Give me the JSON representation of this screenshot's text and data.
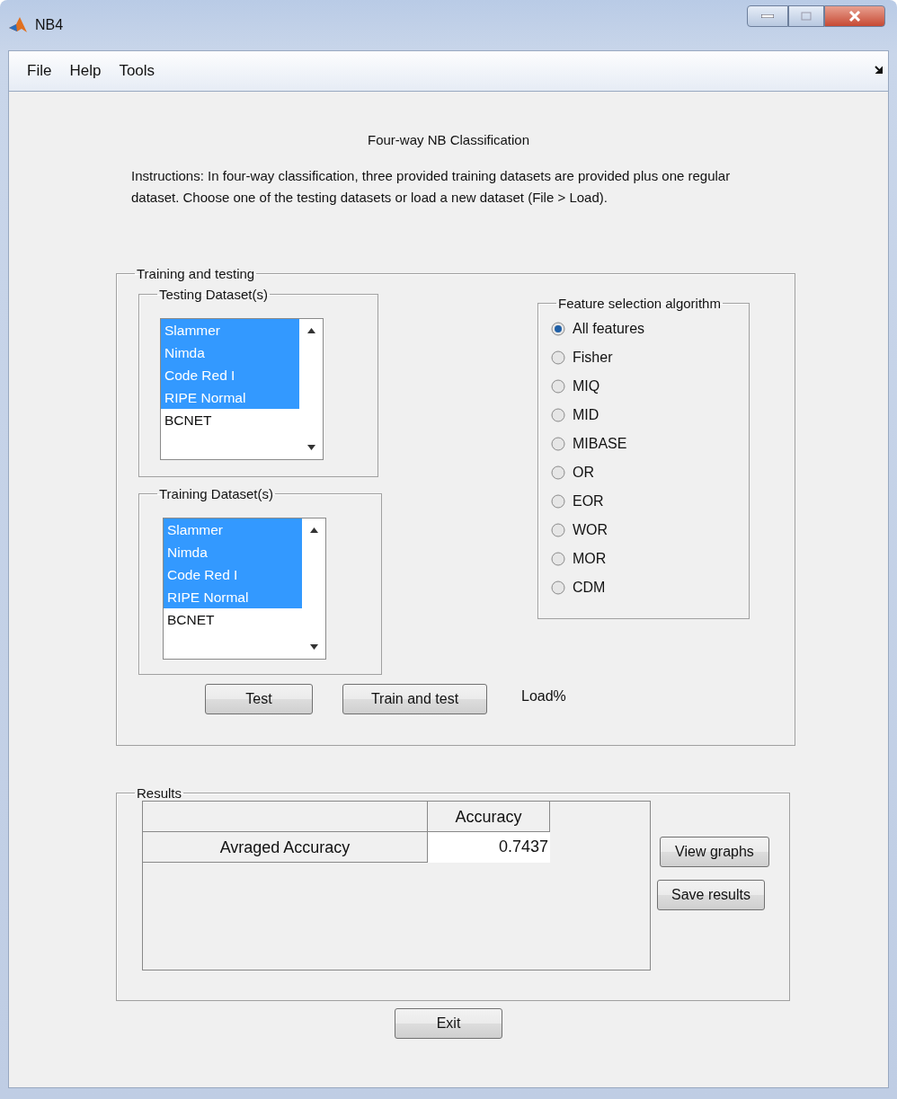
{
  "window": {
    "title": "NB4"
  },
  "menu": [
    "File",
    "Help",
    "Tools"
  ],
  "heading": "Four-way NB Classification",
  "instructions": "Instructions: In four-way classification, three provided training datasets are provided plus one regular dataset. Choose one of the testing datasets or load a new dataset (File > Load).",
  "training_panel": {
    "title": "Training and testing",
    "testing": {
      "title": "Testing Dataset(s)",
      "items": [
        {
          "label": "Slammer",
          "selected": true
        },
        {
          "label": "Nimda",
          "selected": true
        },
        {
          "label": "Code Red I",
          "selected": true
        },
        {
          "label": "RIPE Normal",
          "selected": true
        },
        {
          "label": "BCNET",
          "selected": false
        }
      ]
    },
    "training": {
      "title": "Training Dataset(s)",
      "items": [
        {
          "label": "Slammer",
          "selected": true
        },
        {
          "label": "Nimda",
          "selected": true
        },
        {
          "label": "Code Red I",
          "selected": true
        },
        {
          "label": "RIPE Normal",
          "selected": true
        },
        {
          "label": "BCNET",
          "selected": false
        }
      ]
    },
    "feature": {
      "title": "Feature selection algorithm",
      "options": [
        {
          "label": "All features",
          "selected": true
        },
        {
          "label": "Fisher",
          "selected": false
        },
        {
          "label": "MIQ",
          "selected": false
        },
        {
          "label": "MID",
          "selected": false
        },
        {
          "label": "MIBASE",
          "selected": false
        },
        {
          "label": "OR",
          "selected": false
        },
        {
          "label": "EOR",
          "selected": false
        },
        {
          "label": "WOR",
          "selected": false
        },
        {
          "label": "MOR",
          "selected": false
        },
        {
          "label": "CDM",
          "selected": false
        }
      ]
    },
    "buttons": [
      "Test",
      "Train and test"
    ],
    "load_label": "Load%"
  },
  "results": {
    "title": "Results",
    "table": {
      "columns": [
        "Accuracy"
      ],
      "rows": [
        {
          "label": "Avraged Accuracy",
          "value": "0.7437"
        }
      ]
    },
    "buttons": [
      "View graphs",
      "Save results"
    ]
  },
  "exit": "Exit"
}
